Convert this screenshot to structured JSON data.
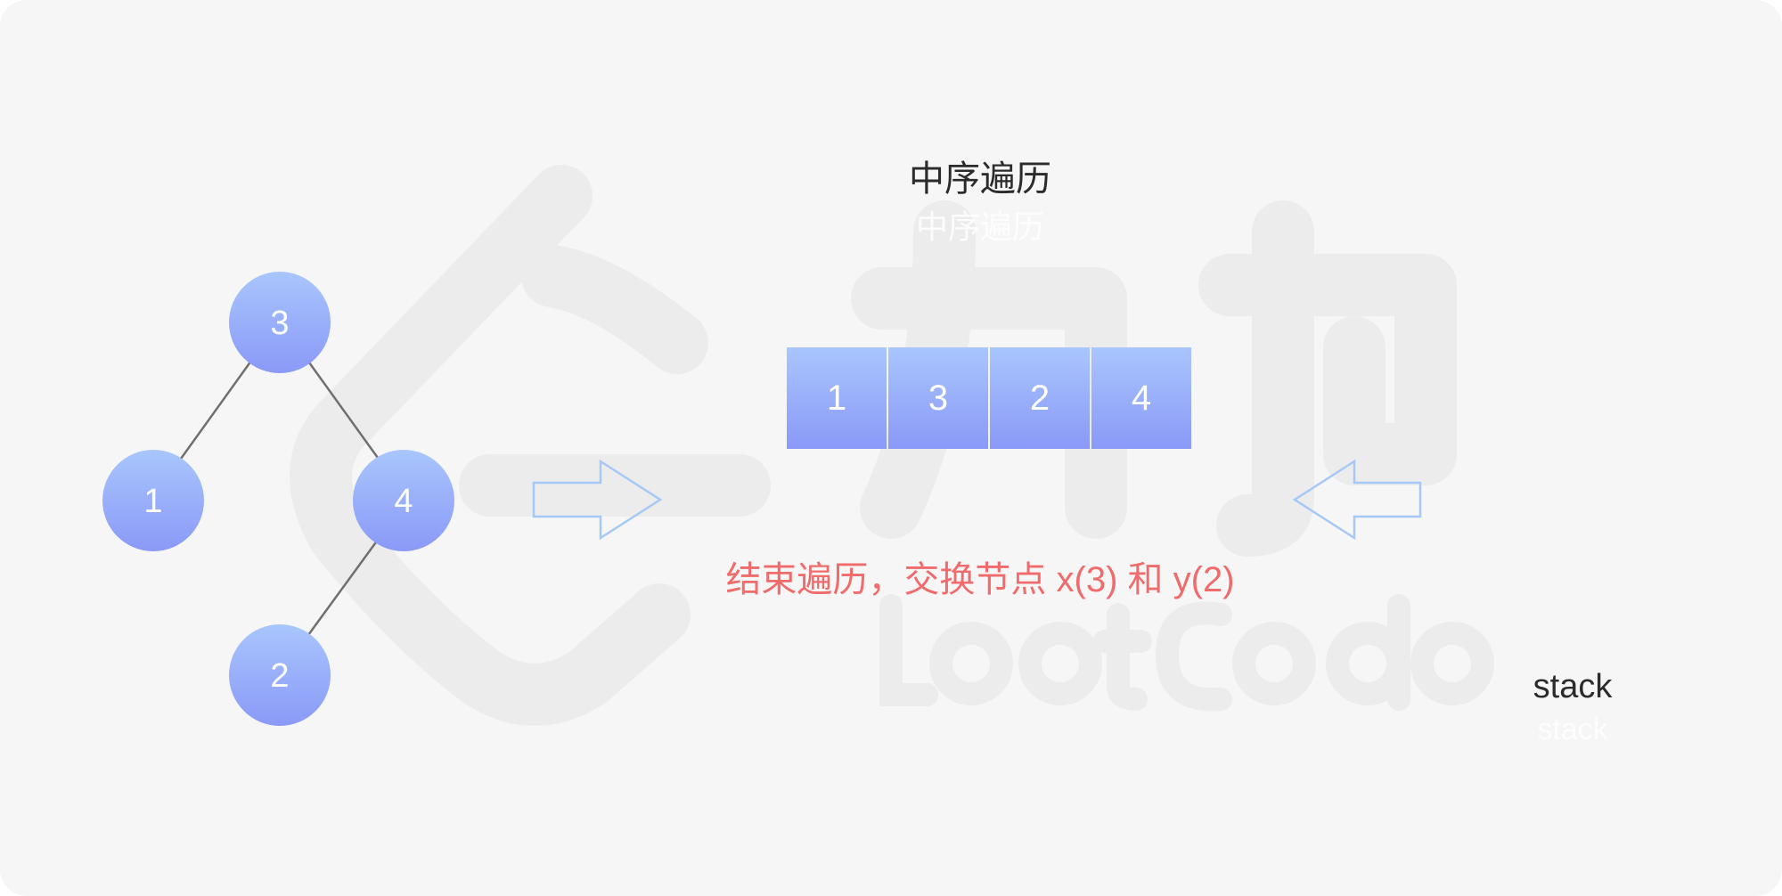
{
  "diagram": {
    "title": "中序遍历",
    "title_ghost": "中序遍历",
    "status_message": "结束遍历，交换节点 x(3) 和 y(2)",
    "stack_label": "stack",
    "stack_label_ghost": "stack",
    "tree": {
      "nodes": [
        {
          "id": "n3",
          "label": "3"
        },
        {
          "id": "n1",
          "label": "1"
        },
        {
          "id": "n4",
          "label": "4"
        },
        {
          "id": "n2",
          "label": "2"
        }
      ],
      "edges": [
        [
          "n3",
          "n1"
        ],
        [
          "n3",
          "n4"
        ],
        [
          "n4",
          "n2"
        ]
      ]
    },
    "inorder_sequence": [
      "1",
      "3",
      "2",
      "4"
    ],
    "colors": {
      "node_top": "#a9c6fd",
      "node_bottom": "#8a99f7",
      "arrow_stroke": "#a6c8f7",
      "status_text": "#f06b6b",
      "background": "#f6f6f6"
    }
  }
}
